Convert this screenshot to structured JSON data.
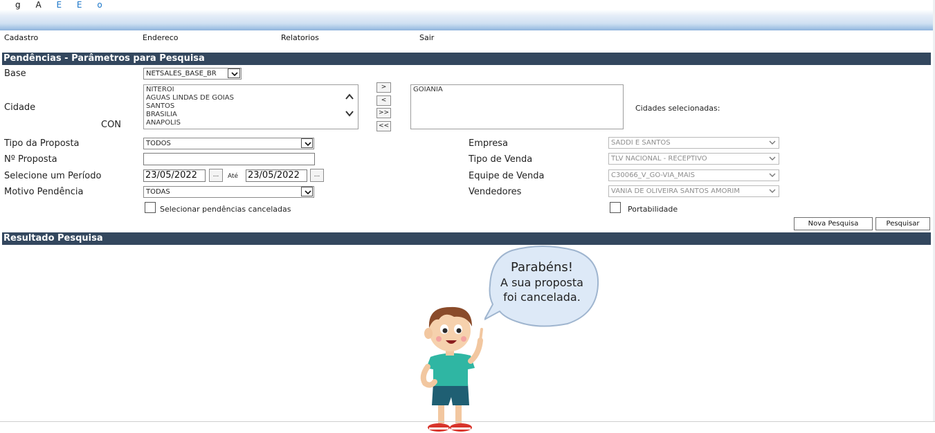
{
  "header": {
    "glyphs": [
      "g",
      "A",
      "E",
      "E",
      "o"
    ]
  },
  "menu": {
    "items": [
      "Cadastro",
      "Endereco",
      "Relatorios",
      "Sair"
    ]
  },
  "search_section": {
    "title": "Pendências - Parâmetros para Pesquisa",
    "base_label": "Base",
    "base_value": "NETSALES_BASE_BR",
    "cidade_label": "Cidade",
    "con_label": "CON",
    "available_cities": [
      "NITEROI",
      "AGUAS LINDAS DE GOIAS",
      "SANTOS",
      "BRASILIA",
      "ANAPOLIS"
    ],
    "move_buttons": [
      ">",
      "<",
      ">>",
      "<<"
    ],
    "selected_cities": [
      "GOIANIA"
    ],
    "selected_cities_label": "Cidades selecionadas:",
    "tipo_proposta_label": "Tipo da Proposta",
    "tipo_proposta_value": "TODOS",
    "num_proposta_label": "Nº Proposta",
    "num_proposta_value": "",
    "periodo_label": "Selecione um Período",
    "data_inicio": "23/05/2022",
    "ate_label": "Até",
    "data_fim": "23/05/2022",
    "date_picker_label": "...",
    "motivo_label": "Motivo Pendência",
    "motivo_value": "TODAS",
    "canceladas_label": "Selecionar pendências canceladas",
    "empresa_label": "Empresa",
    "empresa_value": "SADDI E SANTOS",
    "tipo_venda_label": "Tipo de Venda",
    "tipo_venda_value": "TLV NACIONAL - RECEPTIVO",
    "equipe_label": "Equipe de Venda",
    "equipe_value": "C30066_V_GO-VIA_MAIS",
    "vendedores_label": "Vendedores",
    "vendedores_value": "VANIA DE OLIVEIRA SANTOS AMORIM",
    "portabilidade_label": "Portabilidade",
    "nova_pesquisa_label": "Nova Pesquisa",
    "pesquisar_label": "Pesquisar"
  },
  "result_section": {
    "title": "Resultado Pesquisa"
  },
  "bubble": {
    "line1": "Parabéns!",
    "line2": "A sua proposta",
    "line3": "foi cancelada."
  },
  "colors": {
    "section_bar": "#33475e",
    "bubble_fill": "#dde9f7",
    "bubble_stroke": "#9fb5cf"
  }
}
